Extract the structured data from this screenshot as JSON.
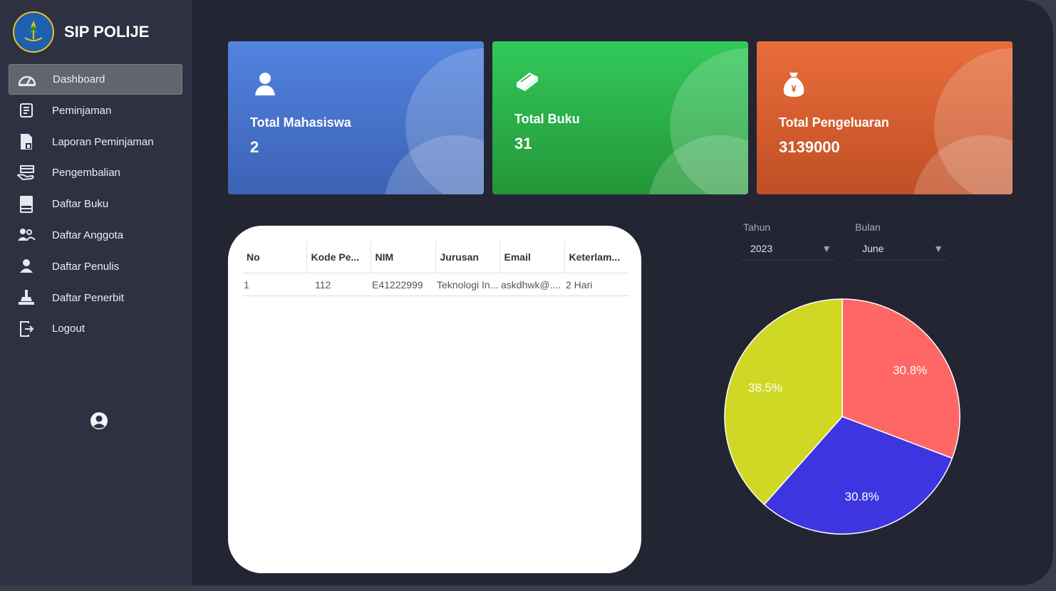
{
  "app": {
    "title": "SIP POLIJE"
  },
  "sidebar": {
    "items": [
      {
        "label": "Dashboard",
        "icon": "dashboard-icon",
        "active": true
      },
      {
        "label": "Peminjaman",
        "icon": "borrow-icon"
      },
      {
        "label": "Laporan Peminjaman",
        "icon": "report-icon"
      },
      {
        "label": "Pengembalian",
        "icon": "return-icon"
      },
      {
        "label": "Daftar Buku",
        "icon": "book-icon"
      },
      {
        "label": "Daftar Anggota",
        "icon": "members-icon"
      },
      {
        "label": "Daftar Penulis",
        "icon": "writer-icon"
      },
      {
        "label": "Daftar Penerbit",
        "icon": "publisher-icon"
      },
      {
        "label": "Logout",
        "icon": "logout-icon"
      }
    ]
  },
  "cards": [
    {
      "label": "Total Mahasiswa",
      "value": "2",
      "icon": "student-icon",
      "color_top": "#5283e0",
      "color_bottom": "#3c62b4"
    },
    {
      "label": "Total Buku",
      "value": "31",
      "icon": "book-stack-icon",
      "color_top": "#33c95a",
      "color_bottom": "#239638"
    },
    {
      "label": "Total Pengeluaran",
      "value": "3139000",
      "icon": "money-bag-icon",
      "color_top": "#e96d3b",
      "color_bottom": "#c04f25"
    }
  ],
  "table": {
    "columns": [
      "No",
      "Kode Pe...",
      "NIM",
      "Jurusan",
      "Email",
      "Keterlam..."
    ],
    "rows": [
      [
        "1",
        "112",
        "E41222999",
        "Teknologi In...",
        "askdhwk@....",
        "2 Hari"
      ]
    ]
  },
  "filters": {
    "year": {
      "label": "Tahun",
      "value": "2023"
    },
    "month": {
      "label": "Bulan",
      "value": "June"
    }
  },
  "chart_data": {
    "type": "pie",
    "slices": [
      {
        "label": "30.8%",
        "value": 30.8,
        "color": "#ff6666"
      },
      {
        "label": "30.8%",
        "value": 30.8,
        "color": "#3d36e0"
      },
      {
        "label": "38.5%",
        "value": 38.5,
        "color": "#cfd824"
      }
    ]
  }
}
